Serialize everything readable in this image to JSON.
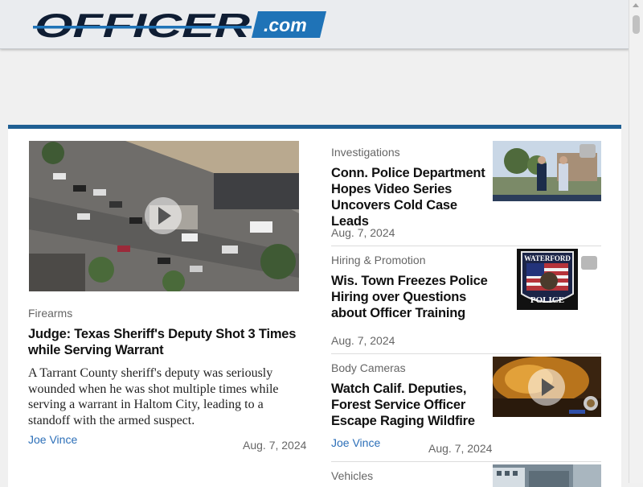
{
  "header": {
    "logo_main": "OFFICER",
    "logo_suffix": ".com",
    "colors": {
      "logo_dark": "#0f1d33",
      "logo_blue": "#1f73b7",
      "accent_bar": "#1f5f93"
    }
  },
  "featured": {
    "category": "Firearms",
    "title": "Judge: Texas Sheriff's Deputy Shot 3 Times while Serving Warrant",
    "summary": "A Tarrant County sheriff's deputy was seriously wounded when he was shot multiple times while serving a warrant in Haltom City, leading to a standoff with the armed suspect.",
    "author": "Joe Vince",
    "date": "Aug. 7, 2024",
    "image_icon": "play-video-icon"
  },
  "articles": [
    {
      "category": "Investigations",
      "title_lines": [
        "Conn. Police Department",
        "Hopes Video Series",
        "Uncovers Cold Case Leads"
      ],
      "date": "Aug. 7, 2024",
      "image_icon": "officers-photo"
    },
    {
      "category": "Hiring & Promotion",
      "title_lines": [
        "Wis. Town Freezes Police",
        "Hiring over Questions",
        "about Officer Training"
      ],
      "date": "Aug. 7, 2024",
      "image_icon": "police-patch-image",
      "patch_top": "WATERFORD",
      "patch_bottom": "POLICE"
    },
    {
      "category": "Body Cameras",
      "title_lines": [
        "Watch Calif. Deputies,",
        "Forest Service Officer",
        "Escape Raging Wildfire"
      ],
      "author": "Joe Vince",
      "date": "Aug. 7, 2024",
      "image_icon": "play-video-icon"
    },
    {
      "category": "Vehicles",
      "image_icon": "building-photo"
    }
  ]
}
